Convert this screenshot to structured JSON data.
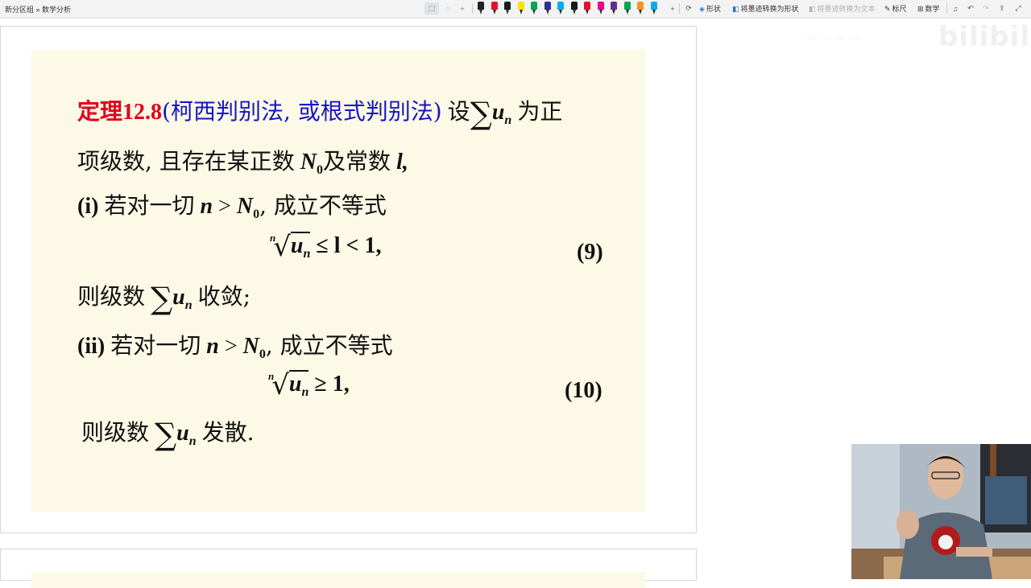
{
  "toolbar": {
    "breadcrumb": "新分区组 » 数学分析",
    "shape_label": "形状",
    "convert_shape_label": "将墨迹转换为形状",
    "convert_text_label": "将墨迹转换为文本",
    "ruler_label": "标尺",
    "math_label": "数学",
    "pen_colors": [
      "#222222",
      "#e8112d",
      "#1a1a1a",
      "#f5e400",
      "#00a651",
      "#2e3192",
      "#00aeef",
      "#1a1a1a",
      "#e8112d",
      "#ec008c",
      "#662d91",
      "#00a651",
      "#f7941d",
      "#00aeef"
    ]
  },
  "slide": {
    "theorem_label": "定理12.8",
    "theorem_name": "(柯西判别法, 或根式判别法)",
    "intro_1": "设",
    "intro_2": "为正",
    "line2_a": "项级数, 且存在某正数",
    "line2_b": "及常数",
    "case1_label": "(i)",
    "case1_a": "若对一切",
    "case1_b": ", 成立不等式",
    "eq9": "≤ l < 1,",
    "eq9_num": "(9)",
    "conclusion1_a": "则级数",
    "conclusion1_b": "收敛;",
    "case2_label": "(ii)",
    "case2_a": "若对一切",
    "case2_b": ", 成立不等式",
    "eq10": "≥ 1,",
    "eq10_num": "(10)",
    "conclusion2_a": "则级数",
    "conclusion2_b": "发散."
  },
  "colors": {
    "slide_bg": "#fcf9e6",
    "theorem_red": "#e0001b",
    "theorem_blue": "#1515c8"
  },
  "watermark": "bilibili"
}
